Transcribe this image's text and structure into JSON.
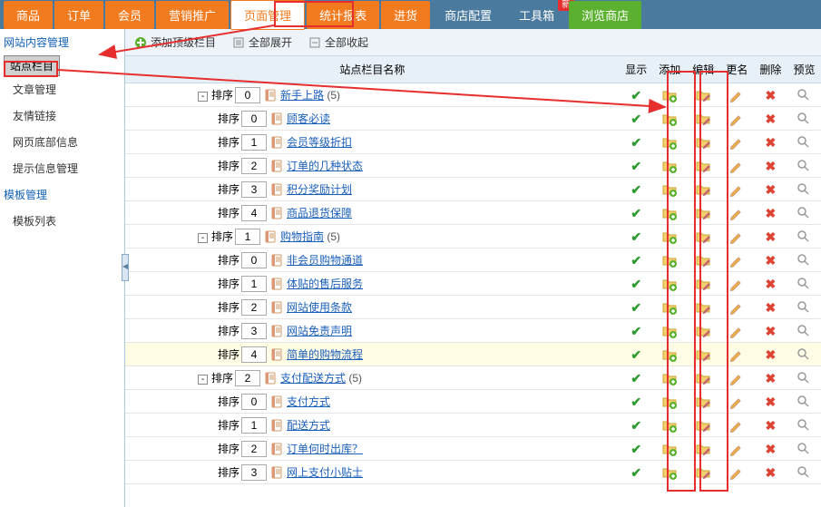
{
  "topnav": {
    "tabs": [
      {
        "label": "商品"
      },
      {
        "label": "订单"
      },
      {
        "label": "会员"
      },
      {
        "label": "营销推广"
      },
      {
        "label": "页面管理",
        "active": true
      },
      {
        "label": "统计报表"
      },
      {
        "label": "进货"
      }
    ],
    "right": [
      {
        "label": "商店配置"
      },
      {
        "label": "工具箱",
        "badge": "新"
      },
      {
        "label": "浏览商店",
        "green": true
      }
    ]
  },
  "sidebar": {
    "sections": [
      {
        "title": "网站内容管理",
        "items": [
          {
            "label": "站点栏目",
            "active": true
          },
          {
            "label": "文章管理"
          },
          {
            "label": "友情链接"
          },
          {
            "label": "网页底部信息"
          },
          {
            "label": "提示信息管理"
          }
        ]
      },
      {
        "title": "模板管理",
        "items": [
          {
            "label": "模板列表"
          }
        ]
      }
    ]
  },
  "toolbar": {
    "add": "添加顶级栏目",
    "expand": "全部展开",
    "collapse": "全部收起"
  },
  "table": {
    "headers": {
      "name": "站点栏目名称",
      "show": "显示",
      "add": "添加",
      "edit": "编辑",
      "rename": "更名",
      "delete": "删除",
      "preview": "预览"
    },
    "sort_label": "排序",
    "rows": [
      {
        "indent": 1,
        "exp": "-",
        "sort": "0",
        "link": "新手上路",
        "count": "(5)"
      },
      {
        "indent": 2,
        "sort": "0",
        "link": "顾客必读"
      },
      {
        "indent": 2,
        "sort": "1",
        "link": "会员等级折扣"
      },
      {
        "indent": 2,
        "sort": "2",
        "link": "订单的几种状态"
      },
      {
        "indent": 2,
        "sort": "3",
        "link": "积分奖励计划"
      },
      {
        "indent": 2,
        "sort": "4",
        "link": "商品退货保障"
      },
      {
        "indent": 1,
        "exp": "-",
        "sort": "1",
        "link": "购物指南",
        "count": "(5)"
      },
      {
        "indent": 2,
        "sort": "0",
        "link": "非会员购物通道"
      },
      {
        "indent": 2,
        "sort": "1",
        "link": "体贴的售后服务"
      },
      {
        "indent": 2,
        "sort": "2",
        "link": "网站使用条款"
      },
      {
        "indent": 2,
        "sort": "3",
        "link": "网站免责声明"
      },
      {
        "indent": 2,
        "sort": "4",
        "link": "简单的购物流程",
        "hl": true
      },
      {
        "indent": 1,
        "exp": "-",
        "sort": "2",
        "link": "支付配送方式",
        "count": "(5)"
      },
      {
        "indent": 2,
        "sort": "0",
        "link": "支付方式"
      },
      {
        "indent": 2,
        "sort": "1",
        "link": "配送方式"
      },
      {
        "indent": 2,
        "sort": "2",
        "link": "订单何时出库？"
      },
      {
        "indent": 2,
        "sort": "3",
        "link": "网上支付小贴士"
      }
    ]
  }
}
